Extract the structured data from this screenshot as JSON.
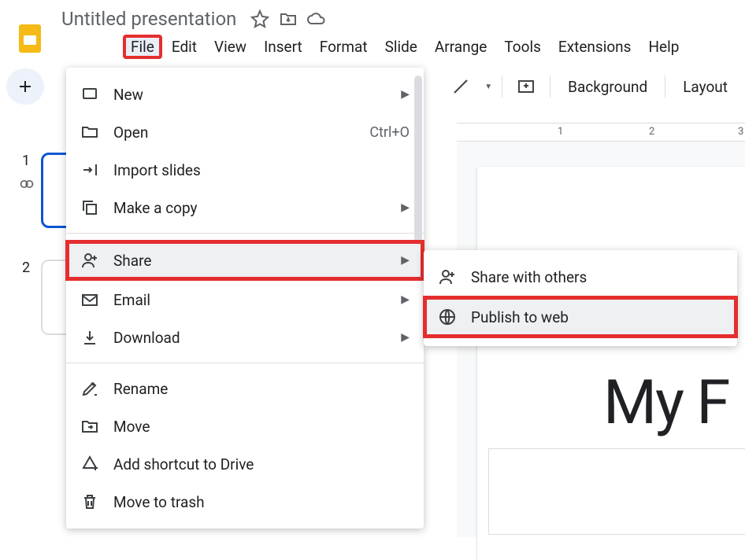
{
  "doc": {
    "title": "Untitled presentation"
  },
  "menubar": {
    "file": "File",
    "edit": "Edit",
    "view": "View",
    "insert": "Insert",
    "format": "Format",
    "slide": "Slide",
    "arrange": "Arrange",
    "tools": "Tools",
    "extensions": "Extensions",
    "help": "Help"
  },
  "toolbar": {
    "background": "Background",
    "layout": "Layout"
  },
  "thumbnails": {
    "n1": "1",
    "n2": "2"
  },
  "file_menu": {
    "new": "New",
    "open": "Open",
    "open_kbd": "Ctrl+O",
    "import": "Import slides",
    "copy": "Make a copy",
    "share": "Share",
    "email": "Email",
    "download": "Download",
    "rename": "Rename",
    "move": "Move",
    "shortcut": "Add shortcut to Drive",
    "trash": "Move to trash"
  },
  "share_menu": {
    "others": "Share with others",
    "publish": "Publish to web"
  },
  "canvas": {
    "title_text": "My F"
  },
  "ruler": {
    "r1": "1",
    "r2": "2",
    "r3": "3"
  }
}
